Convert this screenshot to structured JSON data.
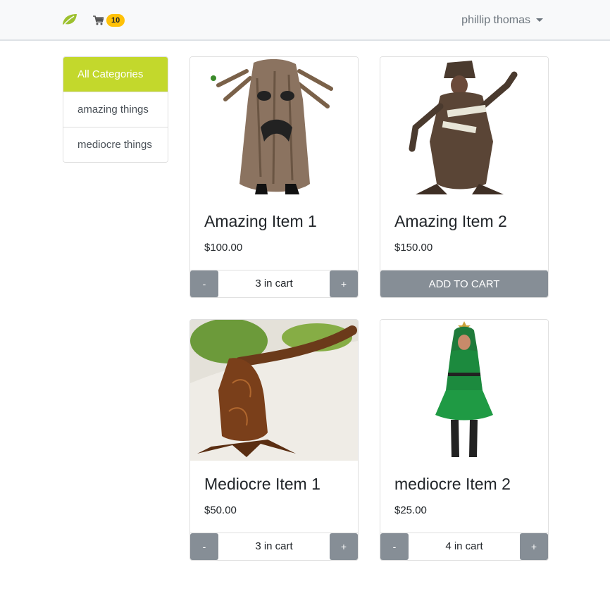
{
  "navbar": {
    "brand_icon": "leaf-icon",
    "brand_color": "#9dc12f",
    "cart_icon": "shopping-cart-icon",
    "cart_count": "10",
    "user_name": "phillip thomas",
    "user_caret_icon": "caret-down-icon"
  },
  "categories": [
    {
      "label": "All Categories",
      "active": true
    },
    {
      "label": "amazing things",
      "active": false
    },
    {
      "label": "mediocre things",
      "active": false
    }
  ],
  "products": [
    {
      "title": "Amazing Item 1",
      "price": "$100.00",
      "cart_label": "3 in cart",
      "in_cart": true,
      "image": "tree-costume-image"
    },
    {
      "title": "Amazing Item 2",
      "price": "$150.00",
      "button_label": "ADD TO CART",
      "in_cart": false,
      "image": "tree-costume-image"
    },
    {
      "title": "Mediocre Item 1",
      "price": "$50.00",
      "cart_label": "3 in cart",
      "in_cart": true,
      "image": "tree-costume-image"
    },
    {
      "title": "mediocre Item 2",
      "price": "$25.00",
      "cart_label": "4 in cart",
      "in_cart": true,
      "image": "christmas-tree-dress-image"
    }
  ],
  "controls": {
    "minus_label": "-",
    "plus_label": "+"
  },
  "colors": {
    "accent": "#c3d82c",
    "button_gray": "#868e96",
    "badge_yellow": "#ffc107"
  }
}
